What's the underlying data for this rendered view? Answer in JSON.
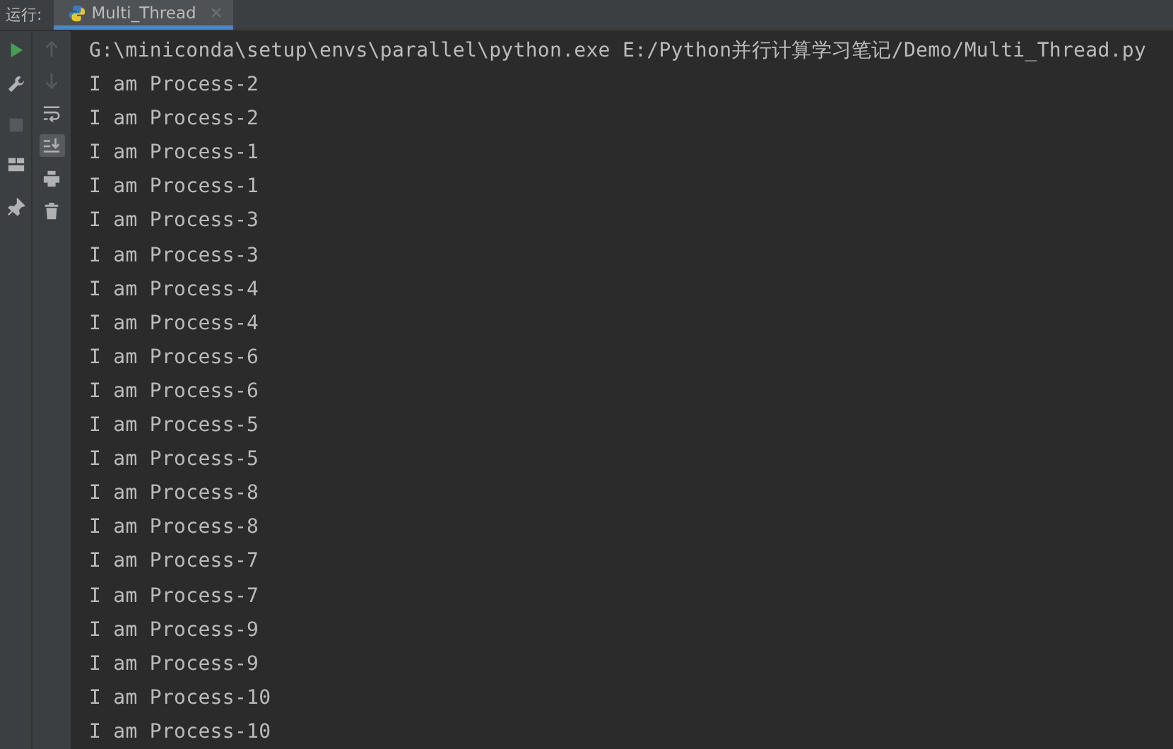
{
  "run_label": "运行:",
  "tabs": [
    {
      "label": "Multi_Thread",
      "selected": true
    }
  ],
  "left_toolbar": [
    {
      "kind": "run",
      "disabled": false
    },
    {
      "kind": "wrench",
      "disabled": false
    },
    {
      "kind": "stop",
      "disabled": true
    },
    {
      "kind": "layout",
      "disabled": false
    },
    {
      "kind": "pin",
      "disabled": false
    }
  ],
  "right_toolbar": [
    {
      "kind": "up",
      "disabled": true,
      "selected": false
    },
    {
      "kind": "down",
      "disabled": true,
      "selected": false
    },
    {
      "kind": "wrap",
      "disabled": false,
      "selected": false
    },
    {
      "kind": "scroll-end",
      "disabled": false,
      "selected": true
    },
    {
      "kind": "print",
      "disabled": false,
      "selected": false
    },
    {
      "kind": "trash",
      "disabled": false,
      "selected": false
    }
  ],
  "console_lines": [
    "G:\\miniconda\\setup\\envs\\parallel\\python.exe E:/Python并行计算学习笔记/Demo/Multi_Thread.py",
    "I am Process-2",
    "I am Process-2",
    "I am Process-1",
    "I am Process-1",
    "I am Process-3",
    "I am Process-3",
    "I am Process-4",
    "I am Process-4",
    "I am Process-6",
    "I am Process-6",
    "I am Process-5",
    "I am Process-5",
    "I am Process-8",
    "I am Process-8",
    "I am Process-7",
    "I am Process-7",
    "I am Process-9",
    "I am Process-9",
    "I am Process-10",
    "I am Process-10"
  ]
}
